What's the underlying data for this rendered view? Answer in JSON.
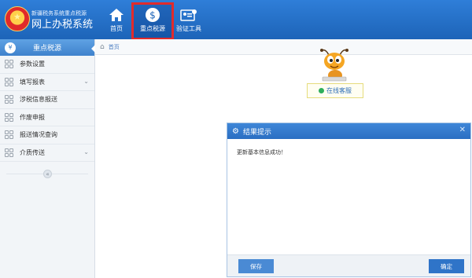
{
  "header": {
    "logo_line1": "新疆税务系统重点税源",
    "logo_line2": "网上办税系统",
    "nav": [
      {
        "label": "首页",
        "icon": "home-icon"
      },
      {
        "label": "重点税源",
        "icon": "dollar-icon"
      },
      {
        "label": "验证工具",
        "icon": "id-card-icon"
      }
    ]
  },
  "sidebar": {
    "title": "重点税源",
    "title_icon": "¥",
    "items": [
      {
        "label": "参数设置",
        "expandable": false
      },
      {
        "label": "填写报表",
        "expandable": true
      },
      {
        "label": "涉税信息报送",
        "expandable": false
      },
      {
        "label": "作废申报",
        "expandable": false
      },
      {
        "label": "报送情况查询",
        "expandable": false
      },
      {
        "label": "介质传送",
        "expandable": true
      }
    ],
    "collapse_glyph": "«"
  },
  "breadcrumb": {
    "home": "首页"
  },
  "support": {
    "label": "在线客服"
  },
  "dialog": {
    "title": "结果提示",
    "message": "更新基本信息成功！",
    "save_label": "保存",
    "ok_label": "确定"
  },
  "colors": {
    "header_blue": "#1d64b8",
    "highlight_red": "#e22b2b",
    "button_blue": "#2f74c8"
  }
}
